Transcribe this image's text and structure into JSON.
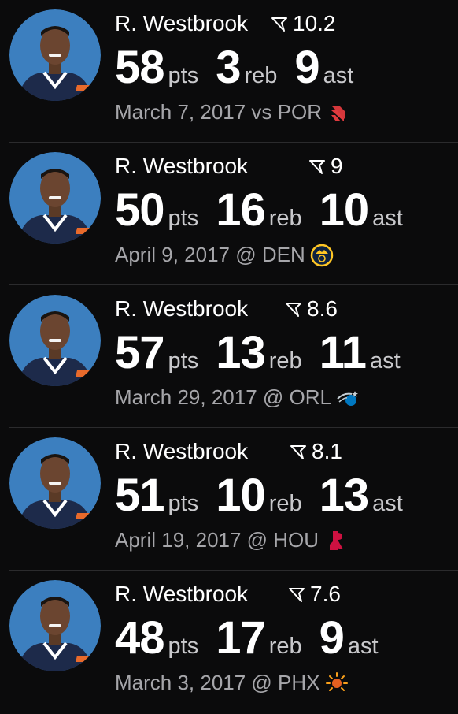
{
  "games": [
    {
      "player": "R. Westbrook",
      "rating": "10.2",
      "pts": "58",
      "pts_label": "pts",
      "reb": "3",
      "reb_label": "reb",
      "ast": "9",
      "ast_label": "ast",
      "game": "March 7, 2017 vs POR",
      "team_logo": "trail-blazers-logo-icon",
      "team_color": "#e03a3e"
    },
    {
      "player": "R. Westbrook",
      "rating": "9",
      "pts": "50",
      "pts_label": "pts",
      "reb": "16",
      "reb_label": "reb",
      "ast": "10",
      "ast_label": "ast",
      "game": "April 9, 2017 @ DEN",
      "team_logo": "nuggets-logo-icon",
      "team_color": "#fec524"
    },
    {
      "player": "R. Westbrook",
      "rating": "8.6",
      "pts": "57",
      "pts_label": "pts",
      "reb": "13",
      "reb_label": "reb",
      "ast": "11",
      "ast_label": "ast",
      "game": "March 29, 2017 @ ORL",
      "team_logo": "magic-logo-icon",
      "team_color": "#0077c0"
    },
    {
      "player": "R. Westbrook",
      "rating": "8.1",
      "pts": "51",
      "pts_label": "pts",
      "reb": "10",
      "reb_label": "reb",
      "ast": "13",
      "ast_label": "ast",
      "game": "April 19, 2017 @ HOU",
      "team_logo": "rockets-logo-icon",
      "team_color": "#ce1141"
    },
    {
      "player": "R. Westbrook",
      "rating": "7.6",
      "pts": "48",
      "pts_label": "pts",
      "reb": "17",
      "reb_label": "reb",
      "ast": "9",
      "ast_label": "ast",
      "game": "March 3, 2017 @ PHX",
      "team_logo": "suns-logo-icon",
      "team_color": "#e56020"
    }
  ],
  "colors": {
    "background": "#0b0b0c",
    "avatar_background": "#3c7fbf",
    "jersey": "#1d2a4a",
    "muted_text": "#a6a6aa"
  }
}
